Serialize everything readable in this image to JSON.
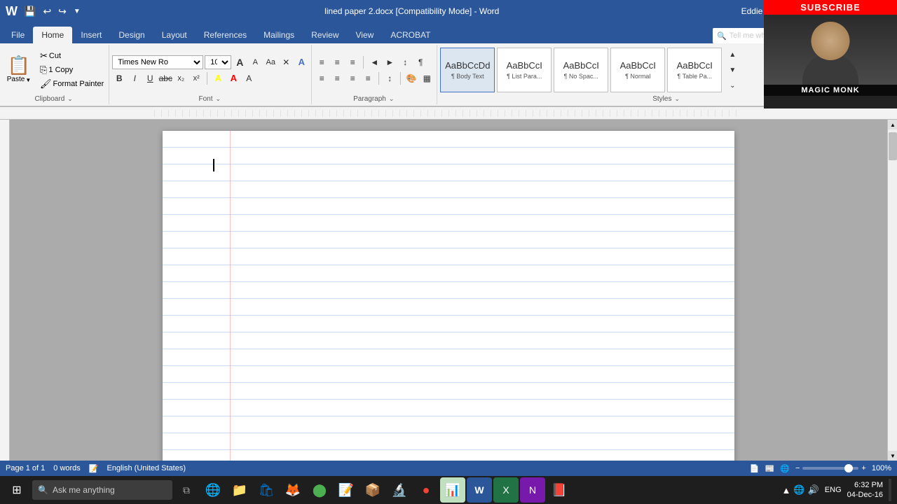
{
  "window": {
    "title": "lined paper 2.docx [Compatibility Mode] - Word",
    "user": "Eddie Monk"
  },
  "qat": {
    "save_label": "💾",
    "undo_label": "↩",
    "redo_label": "↪"
  },
  "tabs": [
    {
      "label": "File",
      "id": "file"
    },
    {
      "label": "Home",
      "id": "home",
      "active": true
    },
    {
      "label": "Insert",
      "id": "insert"
    },
    {
      "label": "Design",
      "id": "design"
    },
    {
      "label": "Layout",
      "id": "layout"
    },
    {
      "label": "References",
      "id": "references"
    },
    {
      "label": "Mailings",
      "id": "mailings"
    },
    {
      "label": "Review",
      "id": "review"
    },
    {
      "label": "View",
      "id": "view"
    },
    {
      "label": "ACROBAT",
      "id": "acrobat"
    }
  ],
  "tell_me": {
    "placeholder": "Tell me what you want to do"
  },
  "ribbon": {
    "clipboard": {
      "label": "Clipboard",
      "paste": "Paste",
      "cut": "✂ Cut",
      "copy": "⎘ Copy",
      "format_painter": "🖌 Format Painter"
    },
    "font": {
      "label": "Font",
      "name": "Times New Ro",
      "size": "10",
      "grow": "A",
      "shrink": "A",
      "change_case": "Aa",
      "clear": "✕",
      "highlight": "A",
      "bold": "B",
      "italic": "I",
      "underline": "U",
      "strikethrough": "abc",
      "subscript": "x₂",
      "superscript": "x²",
      "font_color": "A",
      "text_highlight": "A"
    },
    "paragraph": {
      "label": "Paragraph",
      "bullets": "≡",
      "numbering": "≡#",
      "multilevel": "≡▸",
      "outdent": "◄",
      "indent": "►",
      "sort": "↕",
      "show_para": "¶",
      "align_left": "≡",
      "align_center": "≡",
      "align_right": "≡",
      "justify": "≡",
      "columns": "▤",
      "spacing": "↕",
      "shading": "🎨",
      "borders": "▦"
    },
    "styles": {
      "label": "Styles",
      "items": [
        {
          "preview": "AaBbCcDd",
          "label": "¶ Body Text",
          "active": true
        },
        {
          "preview": "AaBbCcI",
          "label": "¶ List Para..."
        },
        {
          "preview": "AaBbCcI",
          "label": "¶ No Spac..."
        },
        {
          "preview": "AaBbCcI",
          "label": "¶ Normal"
        },
        {
          "preview": "AaBbCcI",
          "label": "¶ Table Pa..."
        }
      ]
    }
  },
  "document": {
    "content": "",
    "cursor_visible": true
  },
  "status_bar": {
    "page": "Page 1 of 1",
    "words": "0 words",
    "language": "English (United States)",
    "zoom": "100%",
    "zoom_value": 75
  },
  "taskbar": {
    "search_placeholder": "Ask me anything",
    "time": "6:32 PM",
    "date": "04-Dec-16",
    "language": "ENG"
  },
  "overlay": {
    "subscribe": "SUBSCRIBE",
    "channel": "MAGIC MONK"
  }
}
